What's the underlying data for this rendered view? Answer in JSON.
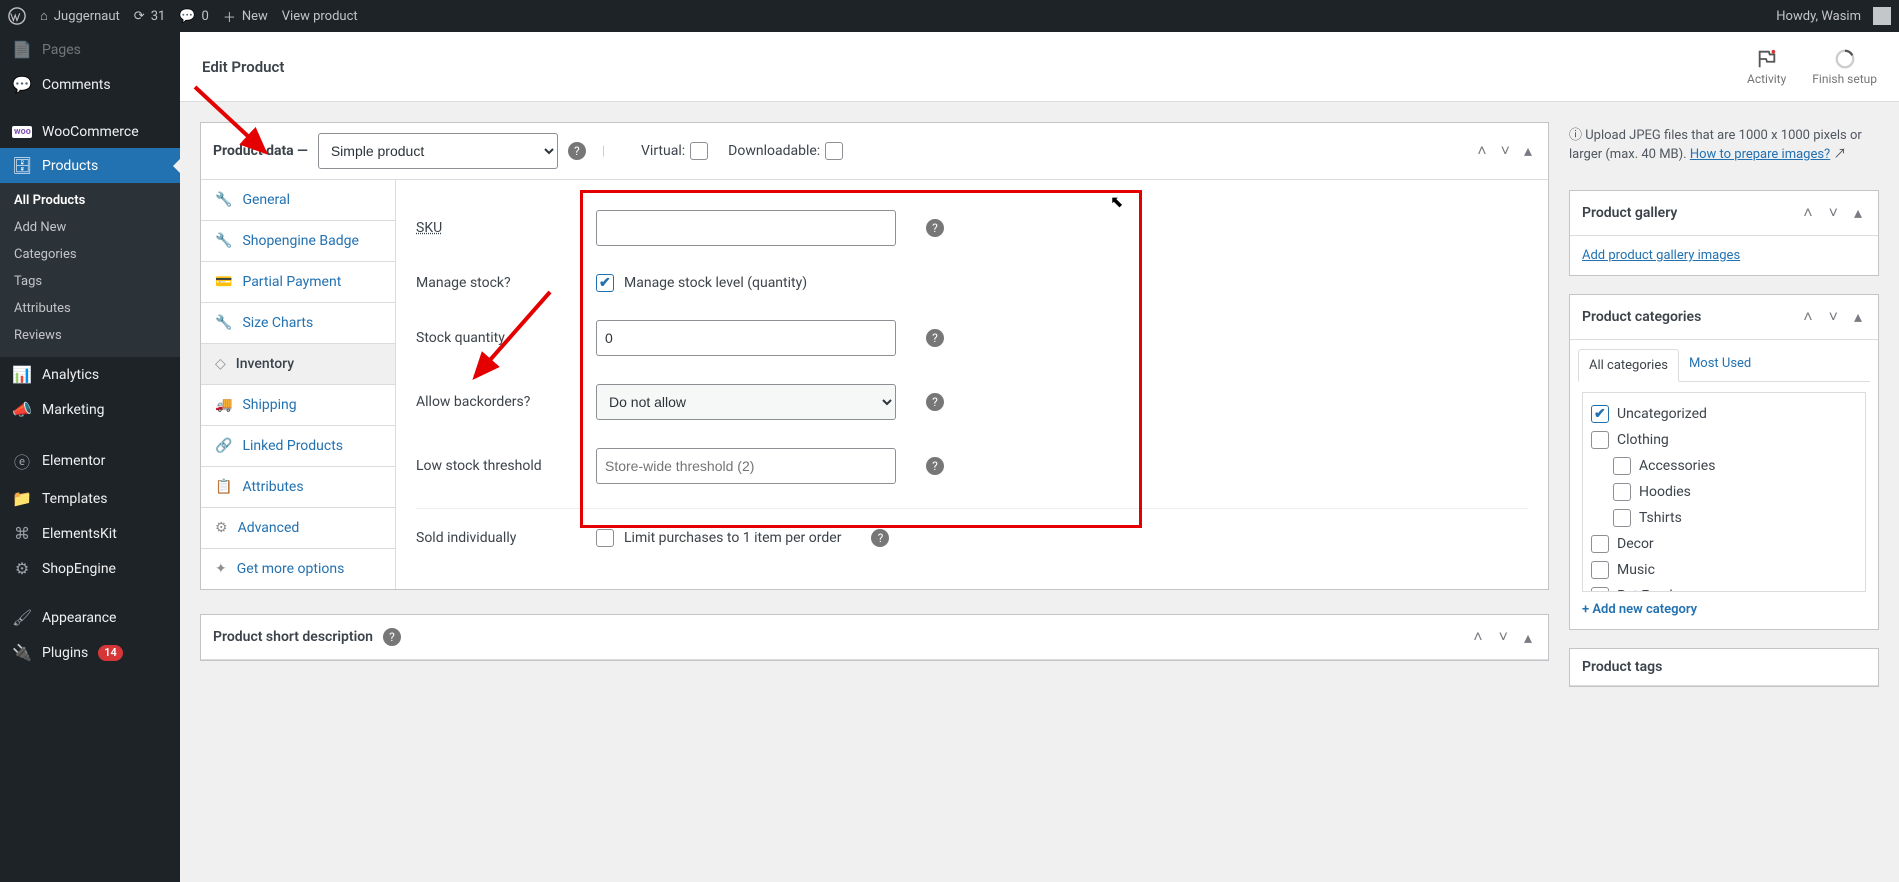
{
  "adminbar": {
    "site": "Juggernaut",
    "updates": "31",
    "comments": "0",
    "new": "New",
    "view": "View product",
    "howdy": "Howdy, Wasim"
  },
  "sidebar": {
    "pages": "Pages",
    "comments": "Comments",
    "woocommerce": "WooCommerce",
    "products": "Products",
    "sub": {
      "all": "All Products",
      "add": "Add New",
      "cats": "Categories",
      "tags": "Tags",
      "attrs": "Attributes",
      "reviews": "Reviews"
    },
    "analytics": "Analytics",
    "marketing": "Marketing",
    "elementor": "Elementor",
    "templates": "Templates",
    "elementskit": "ElementsKit",
    "shopengine": "ShopEngine",
    "appearance": "Appearance",
    "plugins": "Plugins",
    "plugins_badge": "14"
  },
  "header": {
    "title": "Edit Product",
    "activity": "Activity",
    "finish": "Finish setup"
  },
  "upload_hint": {
    "line": "Upload JPEG files that are 1000 x 1000 pixels or larger (max. 40 MB). ",
    "link": "How to prepare images?"
  },
  "product_data": {
    "title": "Product data —",
    "type": "Simple product",
    "virtual": "Virtual:",
    "downloadable": "Downloadable:",
    "tabs": {
      "general": "General",
      "badge": "Shopengine Badge",
      "partial": "Partial Payment",
      "size": "Size Charts",
      "inventory": "Inventory",
      "shipping": "Shipping",
      "linked": "Linked Products",
      "attributes": "Attributes",
      "advanced": "Advanced",
      "more": "Get more options"
    },
    "fields": {
      "sku_l": "SKU",
      "sku_v": "",
      "manage_l": "Manage stock?",
      "manage_cb": "Manage stock level (quantity)",
      "qty_l": "Stock quantity",
      "qty_v": "0",
      "back_l": "Allow backorders?",
      "back_v": "Do not allow",
      "low_l": "Low stock threshold",
      "low_ph": "Store-wide threshold (2)",
      "sold_l": "Sold individually",
      "sold_cb": "Limit purchases to 1 item per order"
    }
  },
  "shortdesc": {
    "title": "Product short description"
  },
  "gallery": {
    "title": "Product gallery",
    "link": "Add product gallery images"
  },
  "categories": {
    "title": "Product categories",
    "tab_all": "All categories",
    "tab_most": "Most Used",
    "items": {
      "uncat": "Uncategorized",
      "clothing": "Clothing",
      "acc": "Accessories",
      "hoodies": "Hoodies",
      "tshirts": "Tshirts",
      "decor": "Decor",
      "music": "Music",
      "pet": "Pet Food"
    },
    "addnew": "+ Add new category"
  },
  "tags": {
    "title": "Product tags"
  }
}
